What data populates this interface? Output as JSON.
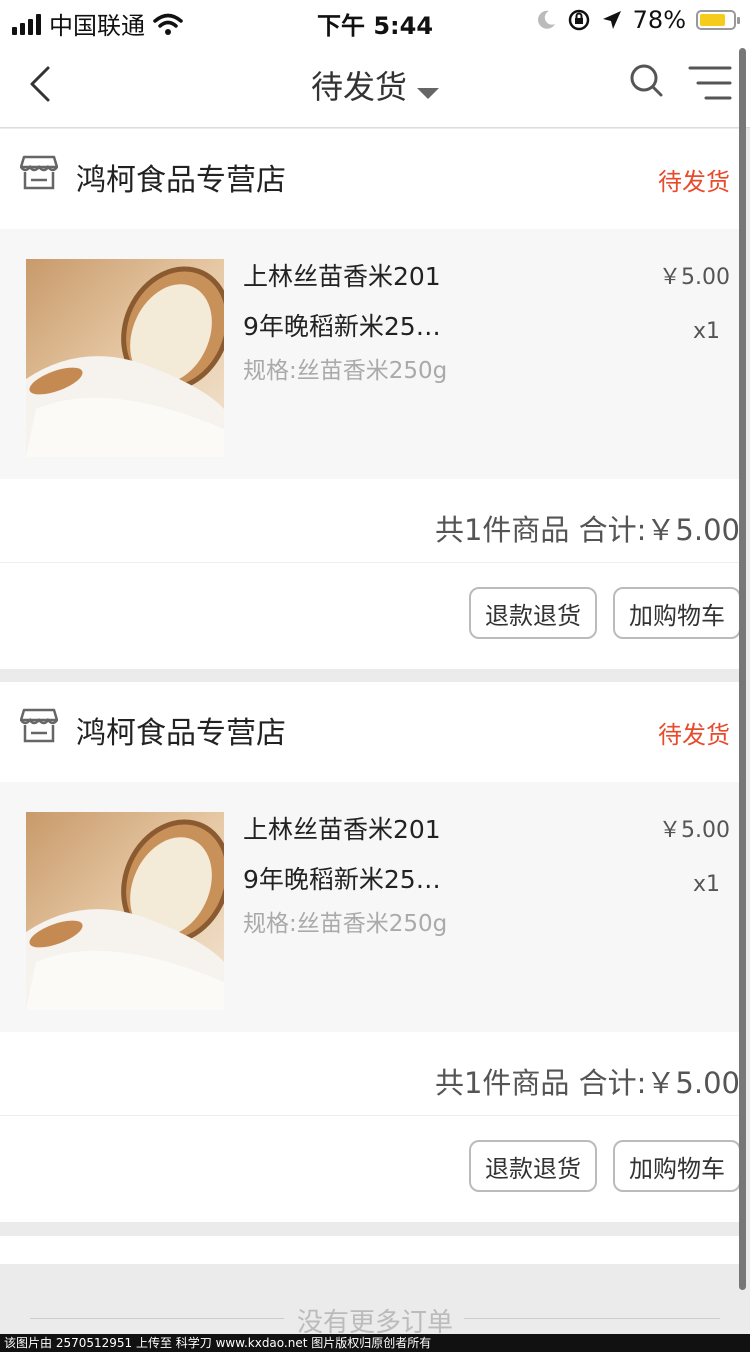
{
  "status_bar": {
    "carrier": "中国联通",
    "time": "下午 5:44",
    "battery": "78%",
    "battery_level": 0.78,
    "icons": [
      "signal-icon",
      "wifi-icon",
      "moon-icon",
      "orientation-lock-icon",
      "location-icon",
      "battery-icon"
    ]
  },
  "nav": {
    "title": "待发货",
    "icons": [
      "back-arrow-icon",
      "dropdown-caret-icon",
      "search-icon",
      "filter-menu-icon"
    ]
  },
  "orders": [
    {
      "shop_name": "鸿柯食品专营店",
      "status": "待发货",
      "goods": {
        "title_line1": "上林丝苗香米201",
        "title_line2": "9年晚稻新米25…",
        "spec": "规格:丝苗香米250g",
        "price": "￥5.00",
        "qty": "x1"
      },
      "total": "共1件商品 合计:￥5.00",
      "buttons": {
        "refund": "退款退货",
        "add_cart": "加购物车"
      }
    },
    {
      "shop_name": "鸿柯食品专营店",
      "status": "待发货",
      "goods": {
        "title_line1": "上林丝苗香米201",
        "title_line2": "9年晚稻新米25…",
        "spec": "规格:丝苗香米250g",
        "price": "￥5.00",
        "qty": "x1"
      },
      "total": "共1件商品 合计:￥5.00",
      "buttons": {
        "refund": "退款退货",
        "add_cart": "加购物车"
      }
    }
  ],
  "footer": {
    "no_more": "没有更多订单",
    "watermark": "该图片由 2570512951 上传至 科学刀 www.kxdao.net 图片版权归原创者所有"
  },
  "colors": {
    "status_red": "#e84a2c",
    "page_bg": "#ebebeb",
    "goods_bg": "#f7f7f7"
  }
}
